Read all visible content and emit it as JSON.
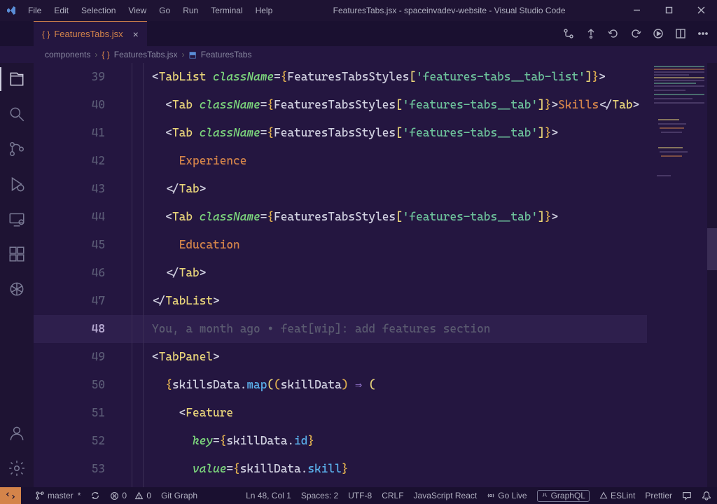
{
  "title": "FeaturesTabs.jsx - spaceinvadev-website - Visual Studio Code",
  "menu": [
    "File",
    "Edit",
    "Selection",
    "View",
    "Go",
    "Run",
    "Terminal",
    "Help"
  ],
  "tab": {
    "name": "FeaturesTabs.jsx"
  },
  "breadcrumb": {
    "a": "components",
    "b": "FeaturesTabs.jsx",
    "c": "FeaturesTabs"
  },
  "lines": [
    {
      "n": "39"
    },
    {
      "n": "40"
    },
    {
      "n": "41"
    },
    {
      "n": "42"
    },
    {
      "n": "43"
    },
    {
      "n": "44"
    },
    {
      "n": "45"
    },
    {
      "n": "46"
    },
    {
      "n": "47"
    },
    {
      "n": "48",
      "cur": true
    },
    {
      "n": "49"
    },
    {
      "n": "50"
    },
    {
      "n": "51"
    },
    {
      "n": "52"
    },
    {
      "n": "53"
    }
  ],
  "code": {
    "l39_comp": "TabList",
    "l39_attr": "className",
    "l39_var": "FeaturesTabsStyles",
    "l39_str": "'features-tabs__tab-list'",
    "tab_comp": "Tab",
    "tab_attr": "className",
    "tab_var": "FeaturesTabsStyles",
    "tab_str": "'features-tabs__tab'",
    "l40_text": "Skills",
    "l42_text": "Experience",
    "l45_text": "Education",
    "l47_close": "TabList",
    "l48_blame": "You, a month ago • feat[wip]: add features section",
    "l49_comp": "TabPanel",
    "l50_a": "skillsData",
    "l50_b": "map",
    "l50_c": "skillData",
    "l51_comp": "Feature",
    "l52_attr": "key",
    "l52_a": "skillData",
    "l52_b": "id",
    "l53_attr": "value",
    "l53_a": "skillData",
    "l53_b": "skill"
  },
  "status": {
    "branch": "master",
    "sync": "",
    "errors": "0",
    "warnings": "0",
    "gitgraph": "Git Graph",
    "cursor": "Ln 48, Col 1",
    "spaces": "Spaces: 2",
    "encoding": "UTF-8",
    "eol": "CRLF",
    "lang": "JavaScript React",
    "golive": "Go Live",
    "graphql": "GraphQL",
    "eslint": "ESLint",
    "prettier": "Prettier"
  }
}
